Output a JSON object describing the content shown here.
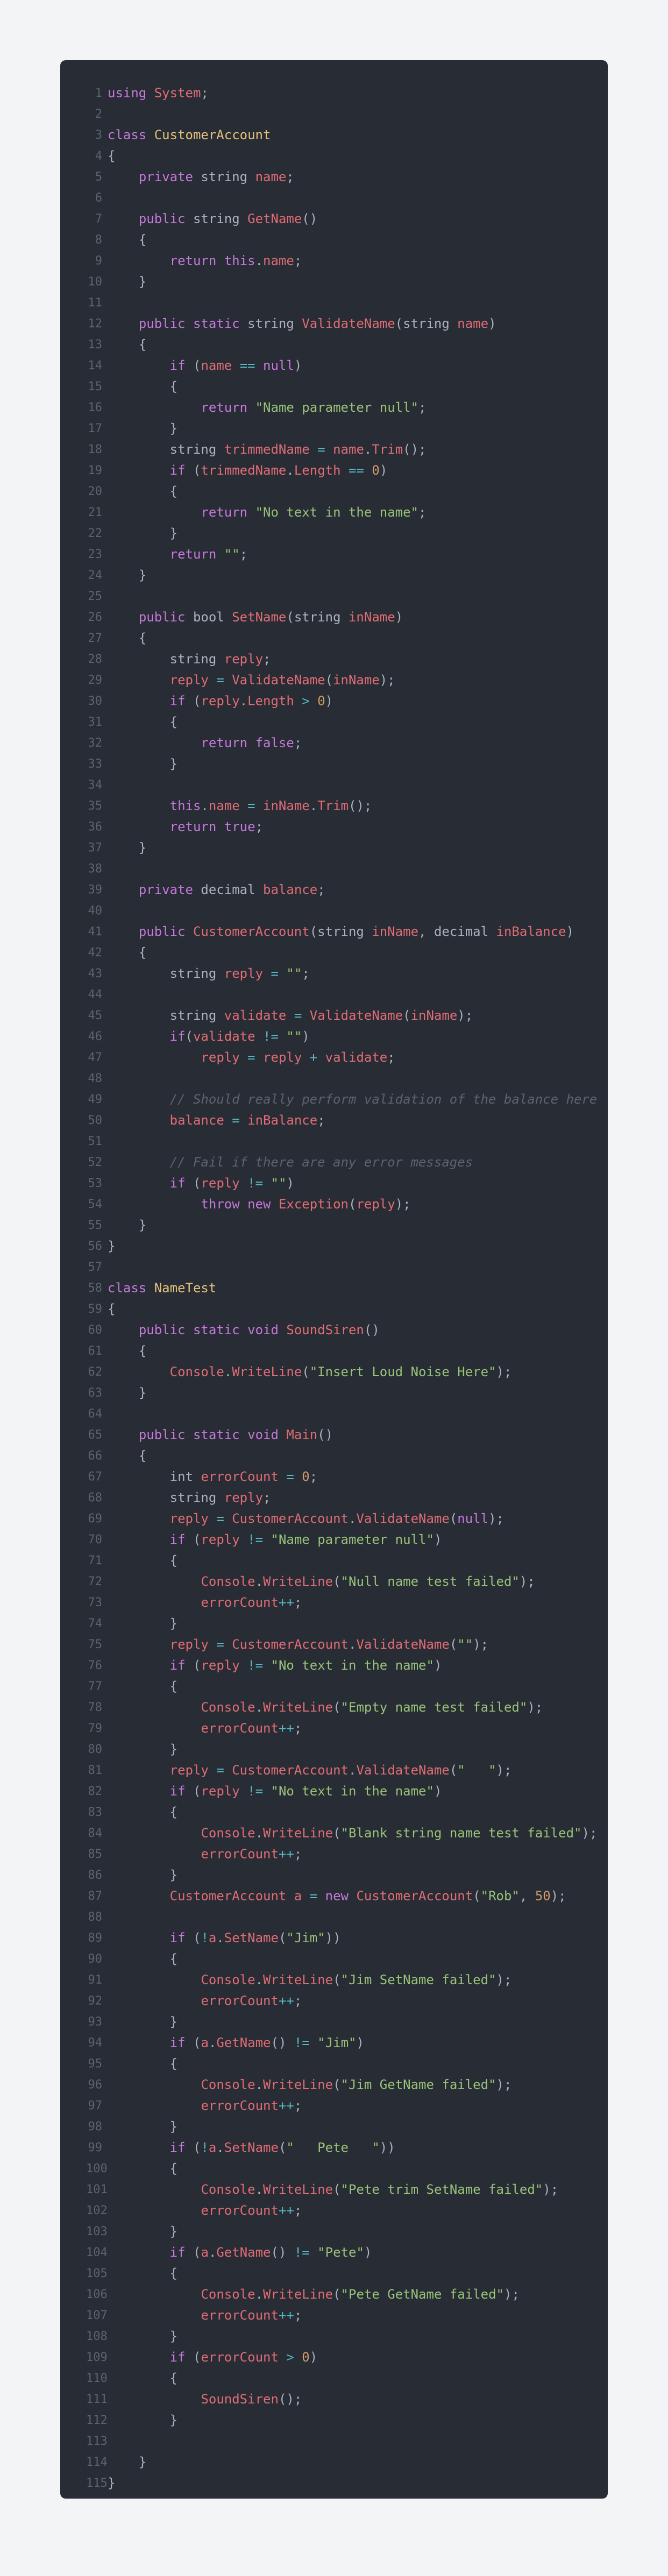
{
  "code_block": {
    "language": "csharp",
    "lines": [
      "using System;",
      "",
      "class CustomerAccount",
      "{",
      "    private string name;",
      "",
      "    public string GetName()",
      "    {",
      "        return this.name;",
      "    }",
      "",
      "    public static string ValidateName(string name)",
      "    {",
      "        if (name == null)",
      "        {",
      "            return \"Name parameter null\";",
      "        }",
      "        string trimmedName = name.Trim();",
      "        if (trimmedName.Length == 0)",
      "        {",
      "            return \"No text in the name\";",
      "        }",
      "        return \"\";",
      "    }",
      "",
      "    public bool SetName(string inName)",
      "    {",
      "        string reply;",
      "        reply = ValidateName(inName);",
      "        if (reply.Length > 0)",
      "        {",
      "            return false;",
      "        }",
      "",
      "        this.name = inName.Trim();",
      "        return true;",
      "    }",
      "",
      "    private decimal balance;",
      "",
      "    public CustomerAccount(string inName, decimal inBalance)",
      "    {",
      "        string reply = \"\";",
      "",
      "        string validate = ValidateName(inName);",
      "        if(validate != \"\")",
      "            reply = reply + validate;",
      "",
      "        // Should really perform validation of the balance here",
      "        balance = inBalance;",
      "",
      "        // Fail if there are any error messages",
      "        if (reply != \"\")",
      "            throw new Exception(reply);",
      "    }",
      "}",
      "",
      "class NameTest",
      "{",
      "    public static void SoundSiren()",
      "    {",
      "        Console.WriteLine(\"Insert Loud Noise Here\");",
      "    }",
      "",
      "    public static void Main()",
      "    {",
      "        int errorCount = 0;",
      "        string reply;",
      "        reply = CustomerAccount.ValidateName(null);",
      "        if (reply != \"Name parameter null\")",
      "        {",
      "            Console.WriteLine(\"Null name test failed\");",
      "            errorCount++;",
      "        }",
      "        reply = CustomerAccount.ValidateName(\"\");",
      "        if (reply != \"No text in the name\")",
      "        {",
      "            Console.WriteLine(\"Empty name test failed\");",
      "            errorCount++;",
      "        }",
      "        reply = CustomerAccount.ValidateName(\"   \");",
      "        if (reply != \"No text in the name\")",
      "        {",
      "            Console.WriteLine(\"Blank string name test failed\");",
      "            errorCount++;",
      "        }",
      "        CustomerAccount a = new CustomerAccount(\"Rob\", 50);",
      "",
      "        if (!a.SetName(\"Jim\"))",
      "        {",
      "            Console.WriteLine(\"Jim SetName failed\");",
      "            errorCount++;",
      "        }",
      "        if (a.GetName() != \"Jim\")",
      "        {",
      "            Console.WriteLine(\"Jim GetName failed\");",
      "            errorCount++;",
      "        }",
      "        if (!a.SetName(\"   Pete   \"))",
      "        {",
      "            Console.WriteLine(\"Pete trim SetName failed\");",
      "            errorCount++;",
      "        }",
      "        if (a.GetName() != \"Pete\")",
      "        {",
      "            Console.WriteLine(\"Pete GetName failed\");",
      "            errorCount++;",
      "        }",
      "        if (errorCount > 0)",
      "        {",
      "            SoundSiren();",
      "        }",
      "",
      "    }",
      "}"
    ]
  },
  "colors": {
    "page_background": "#f3f4f6",
    "panel_background": "#282c34",
    "keyword": "#c678dd",
    "identifier": "#e06c75",
    "type": "#e5c07b",
    "string": "#98c379",
    "number": "#d19a66",
    "comment": "#5c6370",
    "operator": "#56b6c2",
    "plain": "#abb2bf",
    "line_number": "#5c6370"
  }
}
